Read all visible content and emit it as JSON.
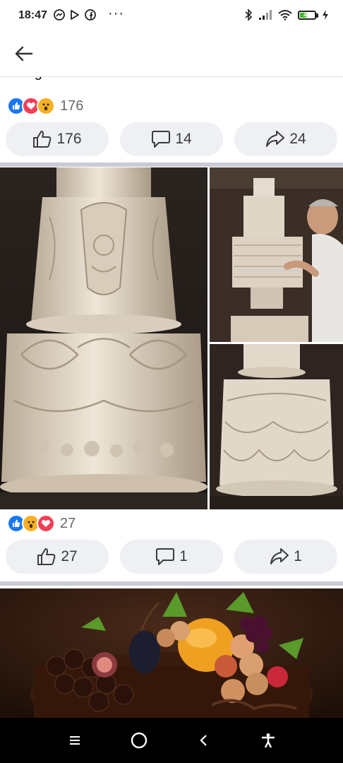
{
  "status_bar": {
    "time": "18:47",
    "overflow": "···",
    "battery_level": "44",
    "icons": [
      "messenger-icon",
      "play-store-icon",
      "facebook-icon",
      "bluetooth-icon",
      "signal-icon",
      "wifi-icon",
      "battery-icon",
      "charging-icon"
    ]
  },
  "header": {
    "back_icon": "arrow-left-icon"
  },
  "post1": {
    "caption_fragment": "design cakes.",
    "reaction_count": "176",
    "reactions": [
      "like",
      "love",
      "wow"
    ],
    "like_count": "176",
    "comment_count": "14",
    "share_count": "24"
  },
  "post2": {
    "photos": [
      "ornate-white-cake-closeup",
      "baker-carving-cake",
      "lace-draped-white-cake"
    ],
    "reaction_count": "27",
    "reactions": [
      "like",
      "wow",
      "love"
    ],
    "like_count": "27",
    "comment_count": "1",
    "share_count": "1"
  },
  "post3": {
    "photo": "chocolate-cake-with-fruit"
  },
  "nav": {
    "icons": [
      "menu-icon",
      "home-icon",
      "back-icon",
      "accessibility-icon"
    ]
  },
  "colors": {
    "like": "#1877f2",
    "love": "#f33e58",
    "wow": "#f7b125",
    "pill": "#eef0f3",
    "separator": "#c9ccd1"
  }
}
